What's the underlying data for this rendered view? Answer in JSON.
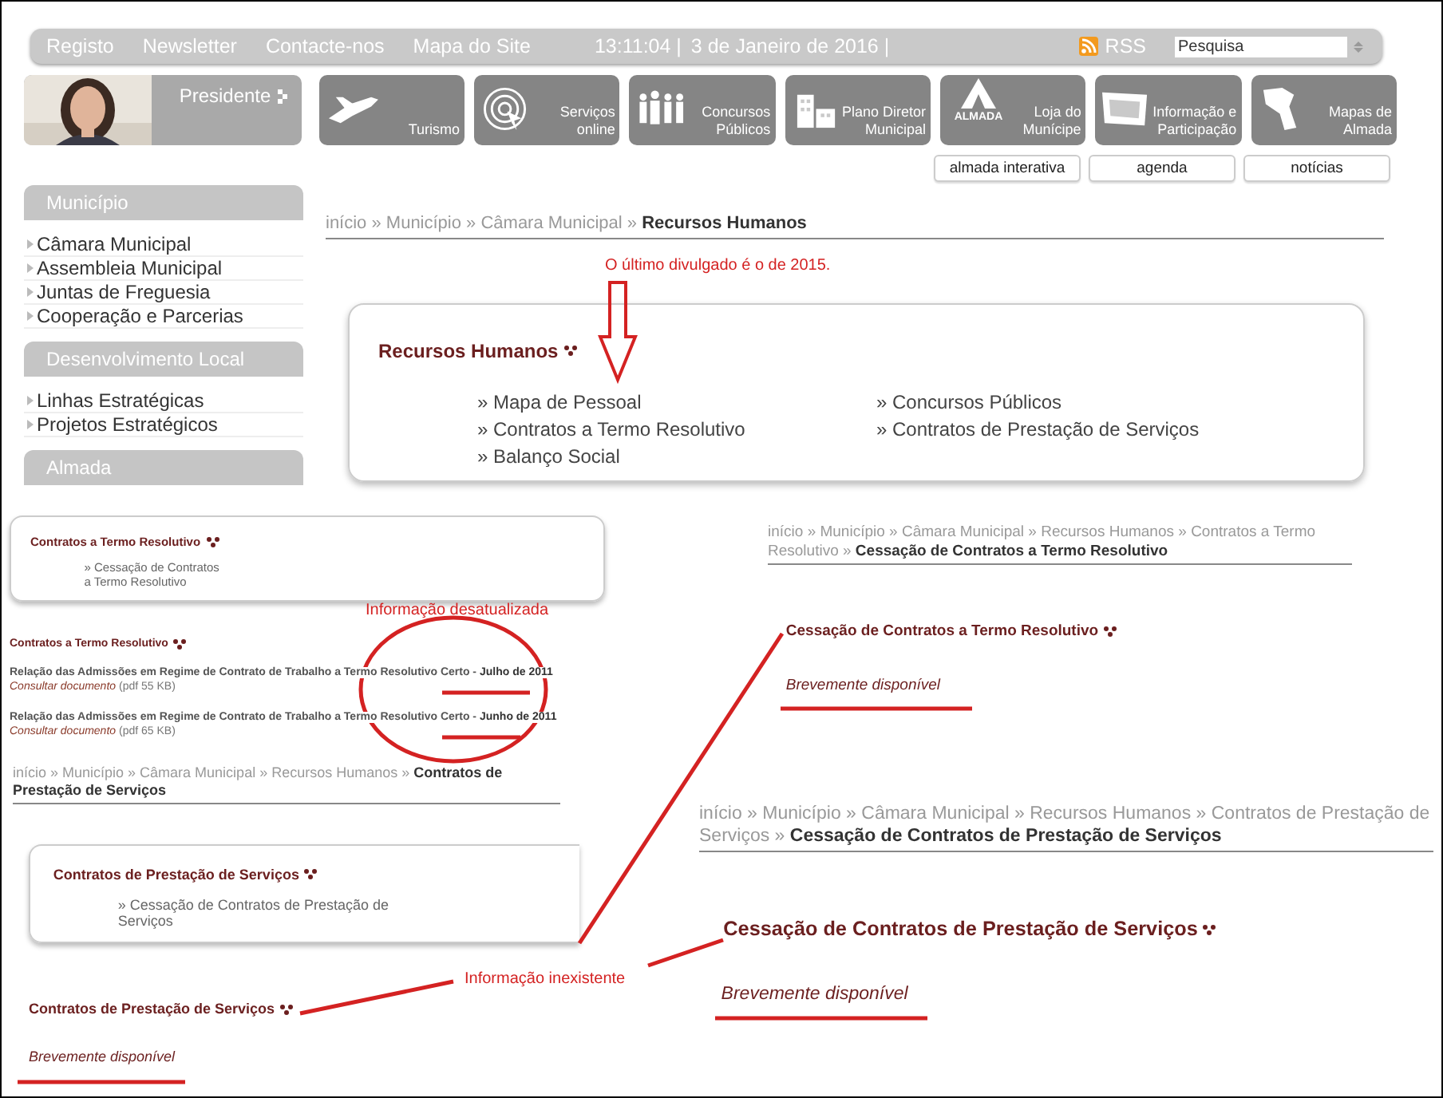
{
  "top_bar": {
    "links": [
      "Registo",
      "Newsletter",
      "Contacte-nos",
      "Mapa do Site"
    ],
    "clock": "13:11:04 |",
    "date": "3 de Janeiro de 2016 |",
    "rss": "RSS",
    "search": {
      "placeholder": "Pesquisa"
    }
  },
  "president": {
    "label": "Presidente"
  },
  "tiles": [
    {
      "kind": "plane",
      "label": "Turismo"
    },
    {
      "kind": "target",
      "label": "Serviços online"
    },
    {
      "kind": "people",
      "label": "Concursos Públicos"
    },
    {
      "kind": "buildings",
      "label": "Plano Diretor Municipal"
    },
    {
      "kind": "logo",
      "logo_text": "ALMADA",
      "label": "Loja do Munícipe"
    },
    {
      "kind": "screen",
      "label": "Informação e Participação"
    },
    {
      "kind": "map",
      "label": "Mapas de Almada"
    }
  ],
  "sub_links": [
    "almada interativa",
    "agenda",
    "notícias"
  ],
  "sidebar": [
    {
      "title": "Município",
      "items": [
        "Câmara Municipal",
        "Assembleia Municipal",
        "Juntas de Freguesia",
        "Cooperação e Parcerias"
      ]
    },
    {
      "title": "Desenvolvimento Local",
      "items": [
        "Linhas Estratégicas",
        "Projetos Estratégicos"
      ]
    },
    {
      "title": "Almada"
    }
  ],
  "main": {
    "breadcrumb": "início » Município » Câmara Municipal » **Recursos Humanos**",
    "title": "Recursos Humanos",
    "columns": [
      [
        "» Mapa de Pessoal",
        "» Contratos a Termo Resolutivo",
        "» Balanço Social"
      ],
      [
        "» Concursos Públicos",
        "» Contratos de Prestação de Serviços"
      ]
    ]
  },
  "fragments": [
    {
      "kind": "card",
      "title": "Contratos a Termo Resolutivo",
      "links": [
        "» Cessação de Contratos a Termo Resolutivo"
      ]
    },
    {
      "kind": "documents",
      "title": "Contratos a Termo Resolutivo",
      "documents": [
        {
          "title": "Relação das Admissões em Regime de Contrato de Trabalho a Termo Resolutivo Certo - **Julho de 2011**",
          "link": "Consultar documento",
          "size": "(pdf 55 KB)"
        },
        {
          "title": "Relação das Admissões em Regime de Contrato de Trabalho a Termo Resolutivo Certo - **Junho de 2011**",
          "link": "Consultar documento",
          "size": "(pdf 65 KB)"
        }
      ]
    },
    {
      "kind": "breadcrumb",
      "breadcrumb": "início » Município » Câmara Municipal » Recursos Humanos » **Contratos de Prestação de Serviços**"
    },
    {
      "kind": "card",
      "title": "Contratos de Prestação de Serviços",
      "links": [
        "» Cessação de Contratos de Prestação de Serviços"
      ]
    },
    {
      "kind": "notice",
      "title": "Contratos de Prestação de Serviços",
      "message": "Brevemente disponível"
    },
    {
      "kind": "page",
      "breadcrumb": "início » Município » Câmara Municipal » Recursos Humanos » Contratos a Termo Resolutivo » **Cessação de Contratos a Termo Resolutivo**",
      "title": "Cessação de Contratos a Termo Resolutivo",
      "message": "Brevemente disponível"
    },
    {
      "kind": "page",
      "breadcrumb": "início » Município » Câmara Municipal » Recursos Humanos » Contratos de Prestação de Serviços » **Cessação de Contratos de Prestação de Serviços**",
      "title": "Cessação de Contratos de Prestação de Serviços",
      "message": "Brevemente disponível"
    }
  ],
  "annotations": {
    "note": "O último divulgado é o de 2015.",
    "outdated": "Informação desatualizada",
    "missing": "Informação inexistente"
  }
}
